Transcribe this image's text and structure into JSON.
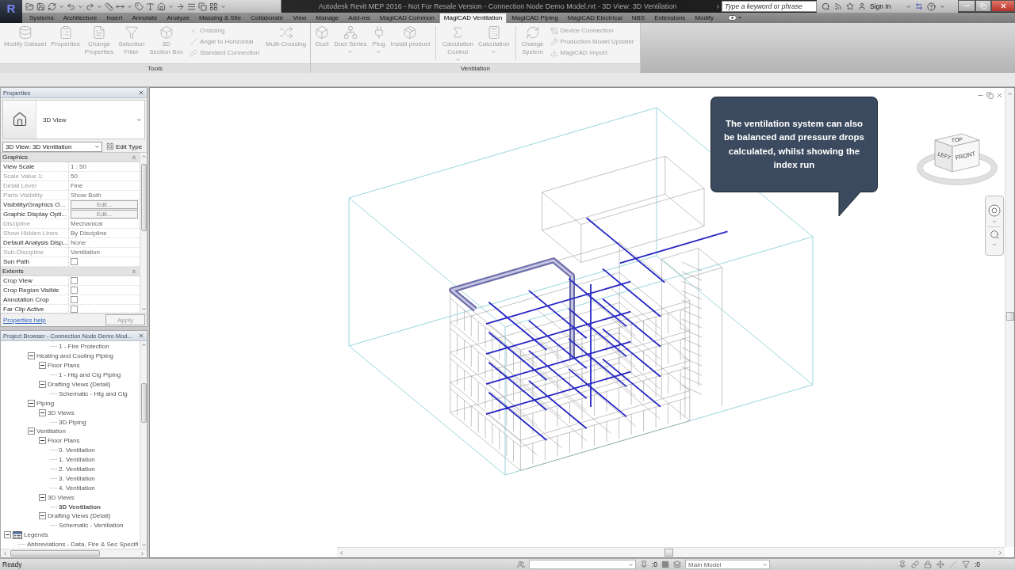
{
  "title_bar": {
    "app_logo": "R",
    "title": "Autodesk Revit MEP 2016 - Not For Resale Version - Connection Node Demo Model.rvt - 3D View: 3D Ventilation",
    "search_placeholder": "Type a keyword or phrase",
    "sign_in": "Sign In"
  },
  "ribbon_tabs": [
    {
      "label": "Systems",
      "selected": false
    },
    {
      "label": "Architecture",
      "selected": false
    },
    {
      "label": "Insert",
      "selected": false
    },
    {
      "label": "Annotate",
      "selected": false
    },
    {
      "label": "Analyze",
      "selected": false
    },
    {
      "label": "Massing & Site",
      "selected": false
    },
    {
      "label": "Collaborate",
      "selected": false
    },
    {
      "label": "View",
      "selected": false
    },
    {
      "label": "Manage",
      "selected": false
    },
    {
      "label": "Add-Ins",
      "selected": false
    },
    {
      "label": "MagiCAD Common",
      "selected": false
    },
    {
      "label": "MagiCAD Ventilation",
      "selected": true
    },
    {
      "label": "MagiCAD Piping",
      "selected": false
    },
    {
      "label": "MagiCAD Electrical",
      "selected": false
    },
    {
      "label": "NBS",
      "selected": false
    },
    {
      "label": "Extensions",
      "selected": false
    },
    {
      "label": "Modify",
      "selected": false
    }
  ],
  "ribbon_panels": [
    {
      "title": "Tools",
      "items": [
        {
          "kind": "large",
          "label": "Modify Dataset",
          "dropdown": false,
          "disabled": true
        },
        {
          "kind": "large",
          "label": "Properties",
          "dropdown": false,
          "disabled": true
        },
        {
          "kind": "large",
          "label": "Change\nProperties",
          "dropdown": false,
          "disabled": true
        },
        {
          "kind": "large",
          "label": "Selection\nFilter",
          "dropdown": false,
          "disabled": true
        },
        {
          "kind": "large",
          "label": "3D\nSection Box",
          "dropdown": false,
          "disabled": true
        },
        {
          "kind": "stack",
          "items": [
            {
              "label": "Crossing",
              "disabled": true
            },
            {
              "label": "Angle to Horizontal",
              "disabled": true
            },
            {
              "label": "Standard Connection",
              "disabled": true
            }
          ]
        },
        {
          "kind": "large",
          "label": "Multi-Crossing",
          "dropdown": false,
          "disabled": true
        }
      ]
    },
    {
      "title": "Ventilation",
      "items": [
        {
          "kind": "large",
          "label": "Duct",
          "dropdown": false,
          "disabled": true
        },
        {
          "kind": "large",
          "label": "Duct Series",
          "dropdown": true,
          "disabled": true
        },
        {
          "kind": "large",
          "label": "Plug",
          "dropdown": true,
          "disabled": true
        },
        {
          "kind": "large",
          "label": "Install product",
          "dropdown": false,
          "disabled": true
        },
        {
          "kind": "separator"
        },
        {
          "kind": "large",
          "label": "Calculation\nControl",
          "dropdown": true,
          "disabled": true
        },
        {
          "kind": "large",
          "label": "Calculation",
          "dropdown": true,
          "disabled": true
        },
        {
          "kind": "separator"
        },
        {
          "kind": "large",
          "label": "Change\nSystem",
          "dropdown": false,
          "disabled": true
        },
        {
          "kind": "stack",
          "items": [
            {
              "label": "Device Connection",
              "disabled": true
            },
            {
              "label": "Production Model Updater",
              "disabled": true
            },
            {
              "label": "MagiCAD Import",
              "disabled": true
            }
          ]
        }
      ]
    }
  ],
  "properties": {
    "title": "Properties",
    "type_name": "3D View",
    "instance": "3D View: 3D Ventilation",
    "edit_type": "Edit Type",
    "groups": [
      {
        "name": "Graphics",
        "expanded": true,
        "rows": [
          {
            "label": "View Scale",
            "kind": "text",
            "value": "1 : 50",
            "disabled": false
          },
          {
            "label": "Scale Value 1:",
            "kind": "text",
            "value": "50",
            "disabled": true
          },
          {
            "label": "Detail Level",
            "kind": "text",
            "value": "Fine",
            "disabled": true
          },
          {
            "label": "Parts Visibility",
            "kind": "text",
            "value": "Show Both",
            "disabled": true
          },
          {
            "label": "Visibility/Graphics O...",
            "kind": "button",
            "value": "Edit...",
            "disabled": false
          },
          {
            "label": "Graphic Display Opti...",
            "kind": "button",
            "value": "Edit...",
            "disabled": false
          },
          {
            "label": "Discipline",
            "kind": "text",
            "value": "Mechanical",
            "disabled": true
          },
          {
            "label": "Show Hidden Lines",
            "kind": "text",
            "value": "By Discipline",
            "disabled": true
          },
          {
            "label": "Default Analysis Disp...",
            "kind": "text",
            "value": "None",
            "disabled": false
          },
          {
            "label": "Sub-Discipline",
            "kind": "text",
            "value": "Ventilation",
            "disabled": true
          },
          {
            "label": "Sun Path",
            "kind": "checkbox",
            "checked": false,
            "disabled": false
          }
        ]
      },
      {
        "name": "Extents",
        "expanded": true,
        "rows": [
          {
            "label": "Crop View",
            "kind": "checkbox",
            "checked": false,
            "disabled": false
          },
          {
            "label": "Crop Region Visible",
            "kind": "checkbox",
            "checked": false,
            "disabled": false
          },
          {
            "label": "Annotation Crop",
            "kind": "checkbox",
            "checked": false,
            "disabled": false
          },
          {
            "label": "Far Clip Active",
            "kind": "checkbox",
            "checked": false,
            "disabled": false
          }
        ]
      }
    ],
    "help_link": "Properties help",
    "apply": {
      "label": "Apply",
      "disabled": true
    }
  },
  "project_browser": {
    "title": "Project Browser - Connection Node Demo Mod...",
    "tree": [
      {
        "children": [
          {
            "children": [
              {
                "children": [
                  {
                    "label": "1 - Fire Protection",
                    "active": false
                  }
                ]
              }
            ]
          },
          {
            "label": "Heating and Cooling Piping",
            "expanded": true,
            "children": [
              {
                "label": "Floor Plans",
                "expanded": true,
                "children": [
                  {
                    "label": "1 - Htg and Clg Piping",
                    "active": false
                  }
                ]
              },
              {
                "label": "Drafting Views (Detail)",
                "expanded": true,
                "children": [
                  {
                    "label": "Schematic - Htg and Clg",
                    "active": false
                  }
                ]
              }
            ]
          },
          {
            "label": "Piping",
            "expanded": true,
            "children": [
              {
                "label": "3D Views",
                "expanded": true,
                "children": [
                  {
                    "label": "3D Piping",
                    "active": false
                  }
                ]
              }
            ]
          },
          {
            "label": "Ventilation",
            "expanded": true,
            "children": [
              {
                "label": "Floor Plans",
                "expanded": true,
                "children": [
                  {
                    "label": "0. Ventilation",
                    "active": false
                  },
                  {
                    "label": "1. Ventilation",
                    "active": false
                  },
                  {
                    "label": "2. Ventilation",
                    "active": false
                  },
                  {
                    "label": "3. Ventilation",
                    "active": false
                  },
                  {
                    "label": "4. Ventilation",
                    "active": false
                  }
                ]
              },
              {
                "label": "3D Views",
                "expanded": true,
                "children": [
                  {
                    "label": "3D Ventilation",
                    "active": true
                  }
                ]
              },
              {
                "label": "Drafting Views (Detail)",
                "expanded": true,
                "children": [
                  {
                    "label": "Schematic - Ventilation",
                    "active": false
                  }
                ]
              }
            ]
          }
        ]
      },
      {
        "label": "Legends",
        "expanded": true,
        "children": [
          {
            "label": "Abbreviations - Data, Fire & Sec Specifi",
            "active": false
          }
        ]
      }
    ]
  },
  "viewport": {
    "callout": "The ventilation system can also be balanced and pressure drops calculated, whilst showing the index run",
    "view_cube_faces": [
      "TOP",
      "LEFT",
      "FRONT"
    ]
  },
  "status_bar": {
    "message": "Ready",
    "selection_count": ":0",
    "model": "Main Model",
    "filter_count": ":0"
  }
}
